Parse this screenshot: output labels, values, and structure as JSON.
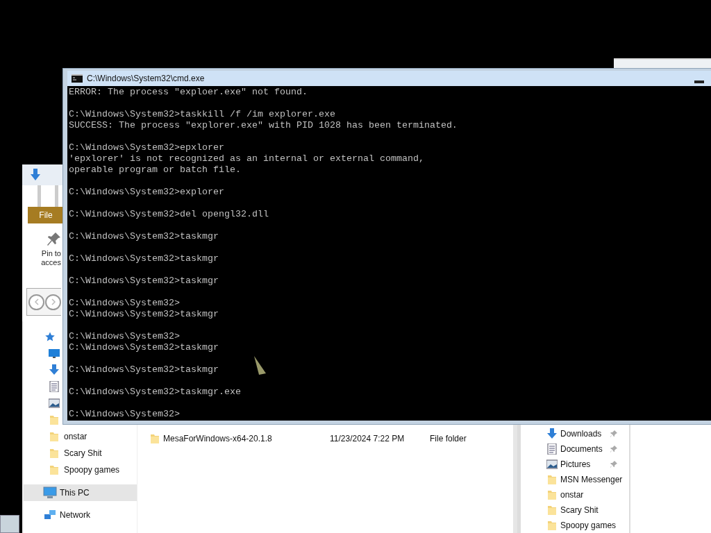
{
  "explorer": {
    "ribbon_tab": "File",
    "pin_button": [
      "Pin to",
      "acces"
    ],
    "nav": [
      {
        "kind": "star",
        "selected": false,
        "children": [
          {
            "kind": "desktop",
            "selected": false
          },
          {
            "kind": "download",
            "selected": false
          },
          {
            "kind": "document",
            "selected": false
          },
          {
            "kind": "picture",
            "selected": false
          },
          {
            "kind": "folder",
            "selected": false
          },
          {
            "label": "onstar",
            "kind": "folder",
            "selected": false
          },
          {
            "label": "Scary Shit",
            "kind": "folder",
            "selected": false
          },
          {
            "label": "Spoopy games",
            "kind": "folder",
            "selected": false
          }
        ]
      },
      {
        "label": "This PC",
        "kind": "pc",
        "selected": true
      },
      {
        "label": "Network",
        "kind": "network",
        "selected": false
      }
    ],
    "rows": [
      {
        "name": "MesaForWindows-x64-20.1.8",
        "date": "11/23/2024 7:22 PM",
        "type": "File folder"
      }
    ]
  },
  "explorer_right": {
    "nav": [
      {
        "label": "Downloads",
        "kind": "download",
        "pinned": true
      },
      {
        "label": "Documents",
        "kind": "document",
        "pinned": true
      },
      {
        "label": "Pictures",
        "kind": "picture",
        "pinned": true
      },
      {
        "label": "MSN Messenger",
        "kind": "folder",
        "pinned": false
      },
      {
        "label": "onstar",
        "kind": "folder",
        "pinned": false
      },
      {
        "label": "Scary Shit",
        "kind": "folder",
        "pinned": false
      },
      {
        "label": "Spoopy games",
        "kind": "folder",
        "pinned": false
      }
    ]
  },
  "console": {
    "title": "C:\\Windows\\System32\\cmd.exe",
    "blocks": [
      [
        "ERROR: The process \"exploer.exe\" not found."
      ],
      [
        "C:\\Windows\\System32>taskkill /f /im explorer.exe",
        "SUCCESS: The process \"explorer.exe\" with PID 1028 has been terminated."
      ],
      [
        "C:\\Windows\\System32>epxlorer",
        "'epxlorer' is not recognized as an internal or external command,",
        "operable program or batch file."
      ],
      [
        "C:\\Windows\\System32>explorer"
      ],
      [
        "C:\\Windows\\System32>del opengl32.dll"
      ],
      [
        "C:\\Windows\\System32>taskmgr"
      ],
      [
        "C:\\Windows\\System32>taskmgr"
      ],
      [
        "C:\\Windows\\System32>taskmgr"
      ],
      [
        "C:\\Windows\\System32>",
        "C:\\Windows\\System32>taskmgr"
      ],
      [
        "C:\\Windows\\System32>",
        "C:\\Windows\\System32>taskmgr"
      ],
      [
        "C:\\Windows\\System32>taskmgr"
      ],
      [
        "C:\\Windows\\System32>taskmgr.exe"
      ],
      [
        "C:\\Windows\\System32>"
      ]
    ]
  }
}
